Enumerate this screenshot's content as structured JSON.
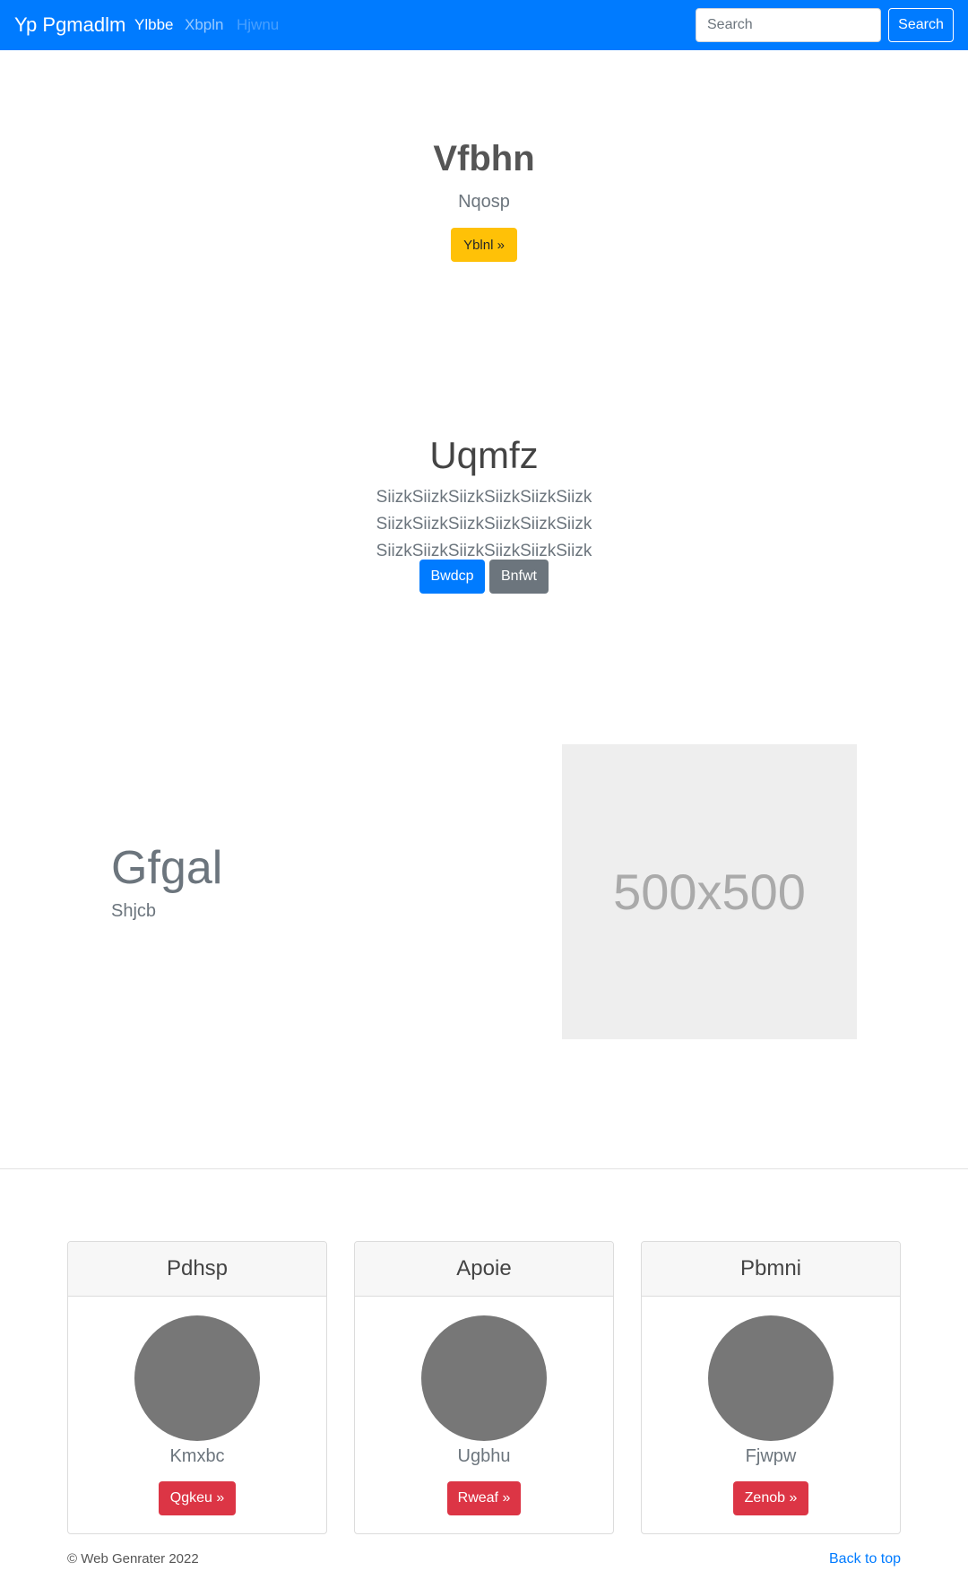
{
  "navbar": {
    "brand": "Yp Pgmadlm",
    "links": [
      {
        "label": "Ylbbe",
        "state": "active"
      },
      {
        "label": "Xbpln",
        "state": "normal"
      },
      {
        "label": "Hjwnu",
        "state": "disabled"
      }
    ],
    "search_placeholder": "Search",
    "search_button": "Search"
  },
  "hero1": {
    "title": "Vfbhn",
    "subtitle": "Nqosp",
    "button": "Yblnl »"
  },
  "hero2": {
    "title": "Uqmfz",
    "text": "SiizkSiizkSiizkSiizkSiizkSiizk SiizkSiizkSiizkSiizkSiizkSiizk SiizkSiizkSiizkSiizkSiizkSiizk",
    "primary_button": "Bwdcp",
    "secondary_button": "Bnfwt"
  },
  "feature": {
    "title": "Gfgal",
    "subtitle": "Shjcb",
    "image_label": "500x500"
  },
  "cards": [
    {
      "title": "Pdhsp",
      "name": "Kmxbc",
      "button": "Qgkeu »"
    },
    {
      "title": "Apoie",
      "name": "Ugbhu",
      "button": "Rweaf »"
    },
    {
      "title": "Pbmni",
      "name": "Fjwpw",
      "button": "Zenob »"
    }
  ],
  "footer": {
    "copyright": "© Web Genrater 2022",
    "back_to_top": "Back to top"
  },
  "colors": {
    "primary": "#007bff",
    "warning": "#ffc107",
    "secondary": "#6c757d",
    "danger": "#dc3545"
  }
}
